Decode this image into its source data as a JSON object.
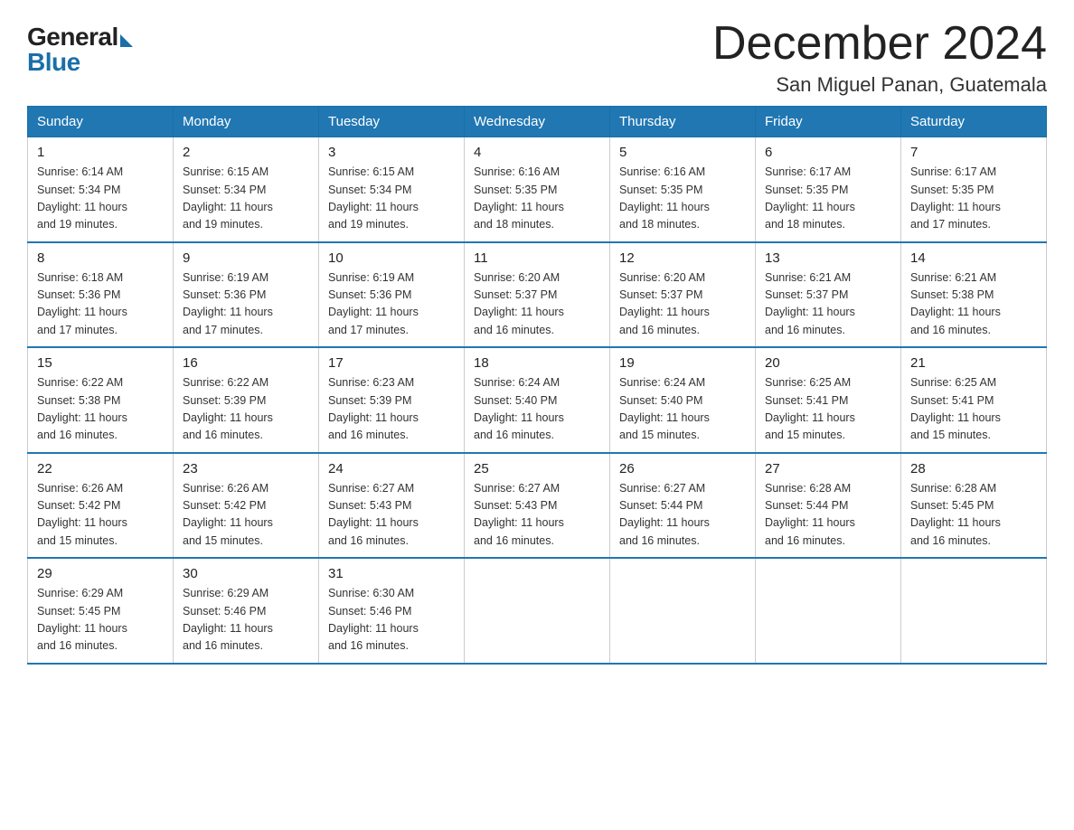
{
  "logo": {
    "general": "General",
    "blue": "Blue"
  },
  "title": {
    "month_year": "December 2024",
    "location": "San Miguel Panan, Guatemala"
  },
  "weekdays": [
    "Sunday",
    "Monday",
    "Tuesday",
    "Wednesday",
    "Thursday",
    "Friday",
    "Saturday"
  ],
  "weeks": [
    [
      {
        "day": "1",
        "sunrise": "6:14 AM",
        "sunset": "5:34 PM",
        "daylight": "11 hours and 19 minutes."
      },
      {
        "day": "2",
        "sunrise": "6:15 AM",
        "sunset": "5:34 PM",
        "daylight": "11 hours and 19 minutes."
      },
      {
        "day": "3",
        "sunrise": "6:15 AM",
        "sunset": "5:34 PM",
        "daylight": "11 hours and 19 minutes."
      },
      {
        "day": "4",
        "sunrise": "6:16 AM",
        "sunset": "5:35 PM",
        "daylight": "11 hours and 18 minutes."
      },
      {
        "day": "5",
        "sunrise": "6:16 AM",
        "sunset": "5:35 PM",
        "daylight": "11 hours and 18 minutes."
      },
      {
        "day": "6",
        "sunrise": "6:17 AM",
        "sunset": "5:35 PM",
        "daylight": "11 hours and 18 minutes."
      },
      {
        "day": "7",
        "sunrise": "6:17 AM",
        "sunset": "5:35 PM",
        "daylight": "11 hours and 17 minutes."
      }
    ],
    [
      {
        "day": "8",
        "sunrise": "6:18 AM",
        "sunset": "5:36 PM",
        "daylight": "11 hours and 17 minutes."
      },
      {
        "day": "9",
        "sunrise": "6:19 AM",
        "sunset": "5:36 PM",
        "daylight": "11 hours and 17 minutes."
      },
      {
        "day": "10",
        "sunrise": "6:19 AM",
        "sunset": "5:36 PM",
        "daylight": "11 hours and 17 minutes."
      },
      {
        "day": "11",
        "sunrise": "6:20 AM",
        "sunset": "5:37 PM",
        "daylight": "11 hours and 16 minutes."
      },
      {
        "day": "12",
        "sunrise": "6:20 AM",
        "sunset": "5:37 PM",
        "daylight": "11 hours and 16 minutes."
      },
      {
        "day": "13",
        "sunrise": "6:21 AM",
        "sunset": "5:37 PM",
        "daylight": "11 hours and 16 minutes."
      },
      {
        "day": "14",
        "sunrise": "6:21 AM",
        "sunset": "5:38 PM",
        "daylight": "11 hours and 16 minutes."
      }
    ],
    [
      {
        "day": "15",
        "sunrise": "6:22 AM",
        "sunset": "5:38 PM",
        "daylight": "11 hours and 16 minutes."
      },
      {
        "day": "16",
        "sunrise": "6:22 AM",
        "sunset": "5:39 PM",
        "daylight": "11 hours and 16 minutes."
      },
      {
        "day": "17",
        "sunrise": "6:23 AM",
        "sunset": "5:39 PM",
        "daylight": "11 hours and 16 minutes."
      },
      {
        "day": "18",
        "sunrise": "6:24 AM",
        "sunset": "5:40 PM",
        "daylight": "11 hours and 16 minutes."
      },
      {
        "day": "19",
        "sunrise": "6:24 AM",
        "sunset": "5:40 PM",
        "daylight": "11 hours and 15 minutes."
      },
      {
        "day": "20",
        "sunrise": "6:25 AM",
        "sunset": "5:41 PM",
        "daylight": "11 hours and 15 minutes."
      },
      {
        "day": "21",
        "sunrise": "6:25 AM",
        "sunset": "5:41 PM",
        "daylight": "11 hours and 15 minutes."
      }
    ],
    [
      {
        "day": "22",
        "sunrise": "6:26 AM",
        "sunset": "5:42 PM",
        "daylight": "11 hours and 15 minutes."
      },
      {
        "day": "23",
        "sunrise": "6:26 AM",
        "sunset": "5:42 PM",
        "daylight": "11 hours and 15 minutes."
      },
      {
        "day": "24",
        "sunrise": "6:27 AM",
        "sunset": "5:43 PM",
        "daylight": "11 hours and 16 minutes."
      },
      {
        "day": "25",
        "sunrise": "6:27 AM",
        "sunset": "5:43 PM",
        "daylight": "11 hours and 16 minutes."
      },
      {
        "day": "26",
        "sunrise": "6:27 AM",
        "sunset": "5:44 PM",
        "daylight": "11 hours and 16 minutes."
      },
      {
        "day": "27",
        "sunrise": "6:28 AM",
        "sunset": "5:44 PM",
        "daylight": "11 hours and 16 minutes."
      },
      {
        "day": "28",
        "sunrise": "6:28 AM",
        "sunset": "5:45 PM",
        "daylight": "11 hours and 16 minutes."
      }
    ],
    [
      {
        "day": "29",
        "sunrise": "6:29 AM",
        "sunset": "5:45 PM",
        "daylight": "11 hours and 16 minutes."
      },
      {
        "day": "30",
        "sunrise": "6:29 AM",
        "sunset": "5:46 PM",
        "daylight": "11 hours and 16 minutes."
      },
      {
        "day": "31",
        "sunrise": "6:30 AM",
        "sunset": "5:46 PM",
        "daylight": "11 hours and 16 minutes."
      },
      null,
      null,
      null,
      null
    ]
  ],
  "labels": {
    "sunrise": "Sunrise:",
    "sunset": "Sunset:",
    "daylight": "Daylight:"
  }
}
